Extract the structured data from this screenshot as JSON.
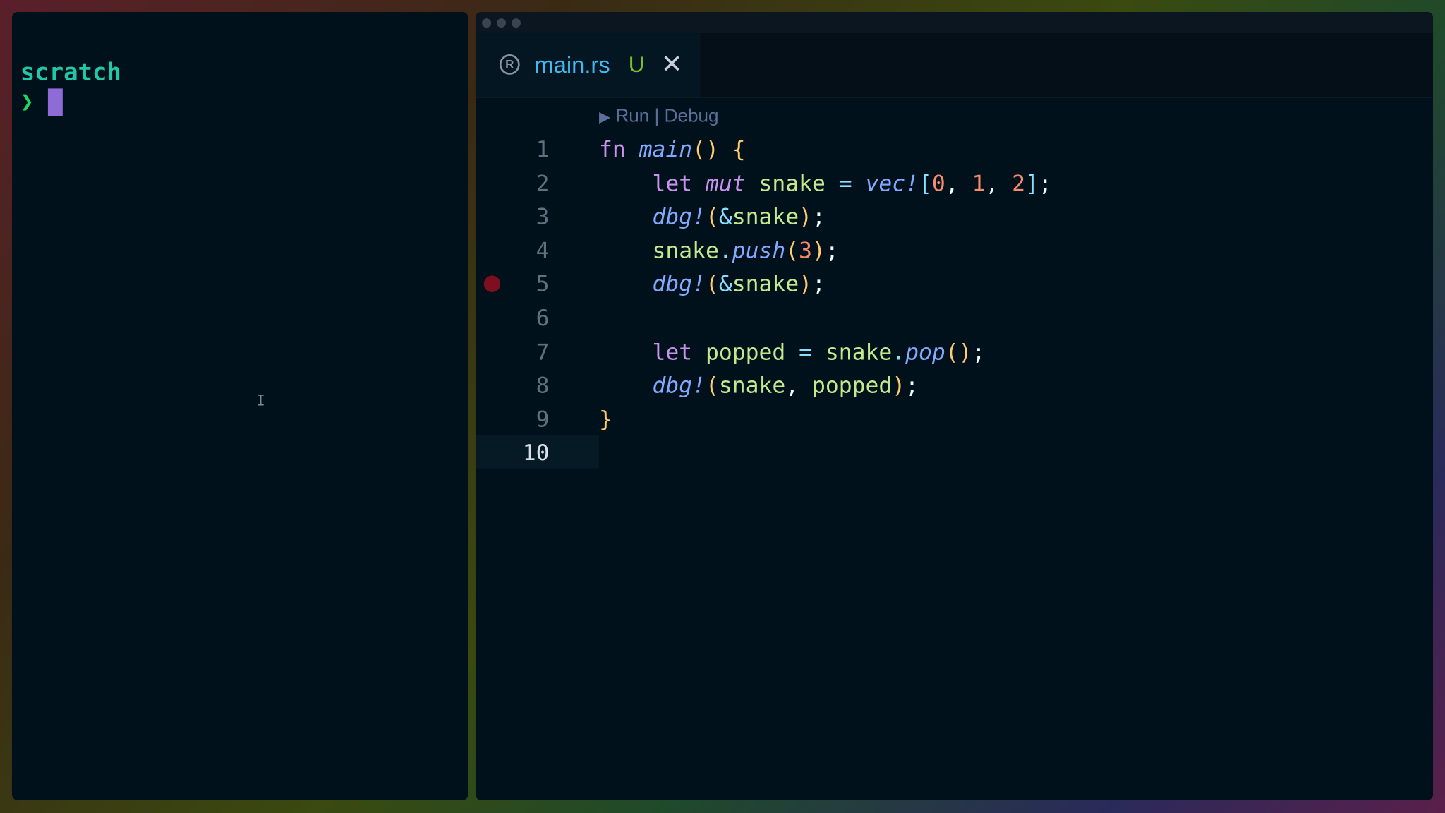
{
  "terminal": {
    "title": "scratch",
    "prompt_symbol": "❯"
  },
  "editor": {
    "tab": {
      "filename": "main.rs",
      "status": "U",
      "close_glyph": "✕",
      "icon": "rust-icon"
    },
    "codelens": {
      "run_label": "Run",
      "separator": "|",
      "debug_label": "Debug"
    },
    "breakpoint_line": 5,
    "active_line": 10,
    "line_numbers": [
      "1",
      "2",
      "3",
      "4",
      "5",
      "6",
      "7",
      "8",
      "9",
      "10"
    ],
    "lines": [
      [
        {
          "t": "fn ",
          "c": "kw"
        },
        {
          "t": "main",
          "c": "fn"
        },
        {
          "t": "()",
          "c": "p1"
        },
        {
          "t": " ",
          "c": "plain"
        },
        {
          "t": "{",
          "c": "p1"
        }
      ],
      [
        {
          "t": "    ",
          "c": "plain"
        },
        {
          "t": "let ",
          "c": "kw"
        },
        {
          "t": "mut ",
          "c": "mut"
        },
        {
          "t": "snake ",
          "c": "id"
        },
        {
          "t": "= ",
          "c": "op"
        },
        {
          "t": "vec!",
          "c": "fn"
        },
        {
          "t": "[",
          "c": "br"
        },
        {
          "t": "0",
          "c": "num"
        },
        {
          "t": ", ",
          "c": "plain"
        },
        {
          "t": "1",
          "c": "num"
        },
        {
          "t": ", ",
          "c": "plain"
        },
        {
          "t": "2",
          "c": "num"
        },
        {
          "t": "]",
          "c": "br"
        },
        {
          "t": ";",
          "c": "plain"
        }
      ],
      [
        {
          "t": "    ",
          "c": "plain"
        },
        {
          "t": "dbg!",
          "c": "fn"
        },
        {
          "t": "(",
          "c": "p1"
        },
        {
          "t": "&",
          "c": "op"
        },
        {
          "t": "snake",
          "c": "id"
        },
        {
          "t": ")",
          "c": "p1"
        },
        {
          "t": ";",
          "c": "plain"
        }
      ],
      [
        {
          "t": "    ",
          "c": "plain"
        },
        {
          "t": "snake",
          "c": "id"
        },
        {
          "t": ".",
          "c": "op"
        },
        {
          "t": "push",
          "c": "fn"
        },
        {
          "t": "(",
          "c": "p1"
        },
        {
          "t": "3",
          "c": "num"
        },
        {
          "t": ")",
          "c": "p1"
        },
        {
          "t": ";",
          "c": "plain"
        }
      ],
      [
        {
          "t": "    ",
          "c": "plain"
        },
        {
          "t": "dbg!",
          "c": "fn"
        },
        {
          "t": "(",
          "c": "p1"
        },
        {
          "t": "&",
          "c": "op"
        },
        {
          "t": "snake",
          "c": "id"
        },
        {
          "t": ")",
          "c": "p1"
        },
        {
          "t": ";",
          "c": "plain"
        }
      ],
      [],
      [
        {
          "t": "    ",
          "c": "plain"
        },
        {
          "t": "let ",
          "c": "kw"
        },
        {
          "t": "popped ",
          "c": "id"
        },
        {
          "t": "= ",
          "c": "op"
        },
        {
          "t": "snake",
          "c": "id"
        },
        {
          "t": ".",
          "c": "op"
        },
        {
          "t": "pop",
          "c": "fn"
        },
        {
          "t": "()",
          "c": "p1"
        },
        {
          "t": ";",
          "c": "plain"
        }
      ],
      [
        {
          "t": "    ",
          "c": "plain"
        },
        {
          "t": "dbg!",
          "c": "fn"
        },
        {
          "t": "(",
          "c": "p1"
        },
        {
          "t": "snake",
          "c": "id"
        },
        {
          "t": ", ",
          "c": "plain"
        },
        {
          "t": "popped",
          "c": "id"
        },
        {
          "t": ")",
          "c": "p1"
        },
        {
          "t": ";",
          "c": "plain"
        }
      ],
      [
        {
          "t": "}",
          "c": "p1"
        }
      ],
      []
    ]
  }
}
